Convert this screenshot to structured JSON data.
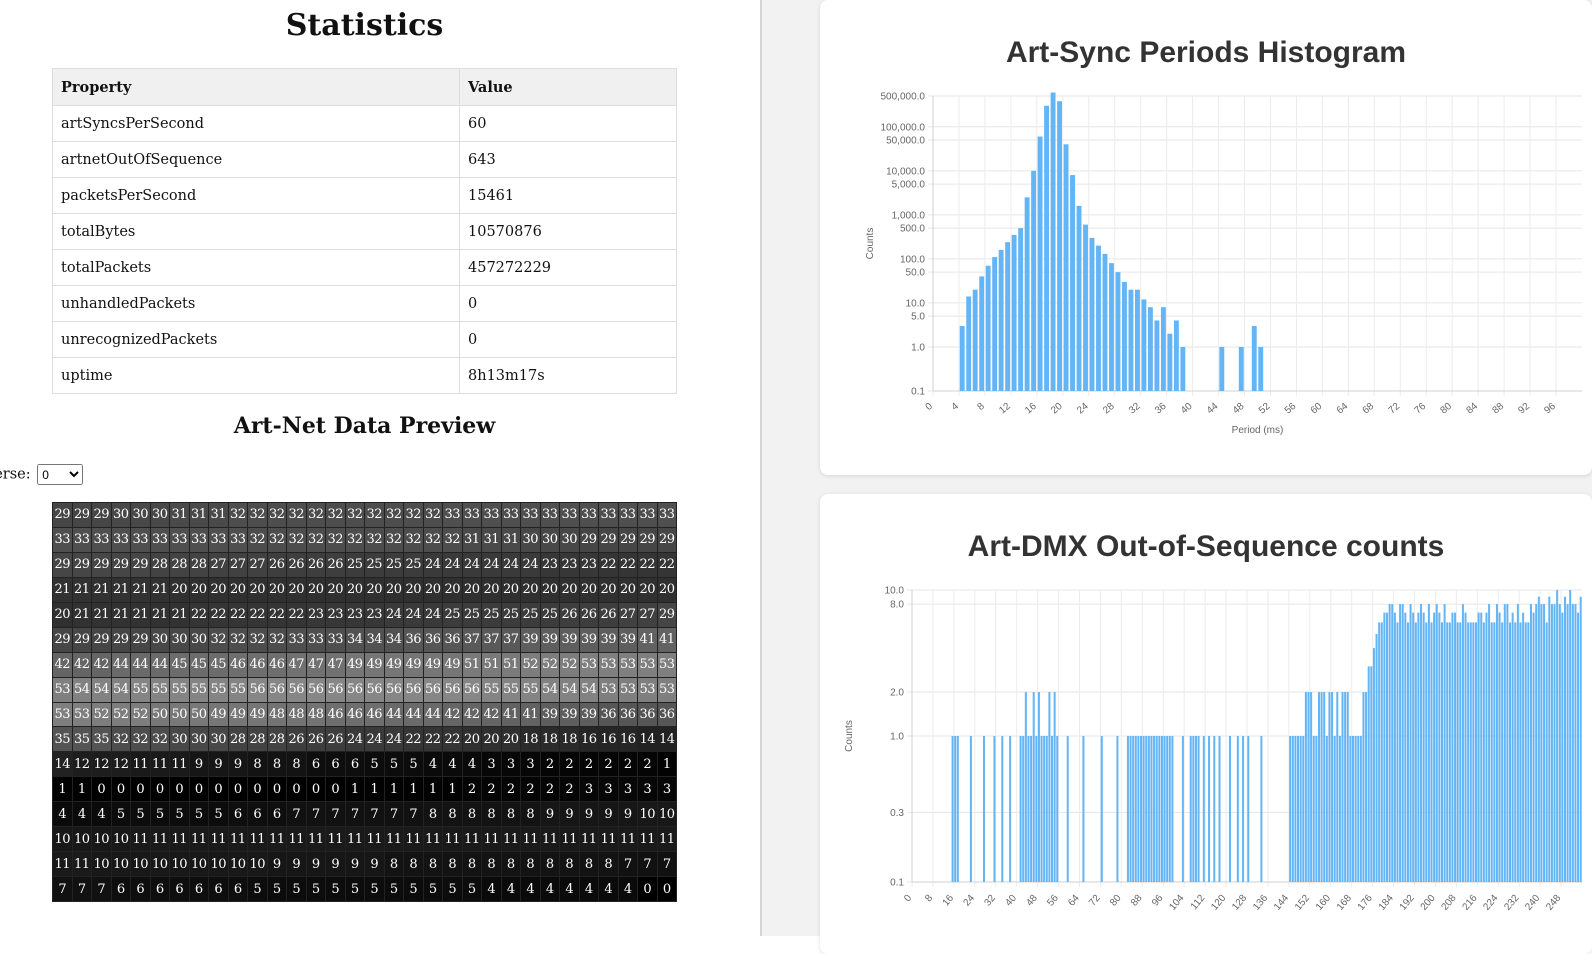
{
  "stats": {
    "title": "Statistics",
    "headers": [
      "Property",
      "Value"
    ],
    "rows": [
      {
        "k": "artSyncsPerSecond",
        "v": "60"
      },
      {
        "k": "artnetOutOfSequence",
        "v": "643"
      },
      {
        "k": "packetsPerSecond",
        "v": "15461"
      },
      {
        "k": "totalBytes",
        "v": "10570876"
      },
      {
        "k": "totalPackets",
        "v": "457272229"
      },
      {
        "k": "unhandledPackets",
        "v": "0"
      },
      {
        "k": "unrecognizedPackets",
        "v": "0"
      },
      {
        "k": "uptime",
        "v": "8h13m17s"
      }
    ]
  },
  "preview": {
    "title": "Art-Net Data Preview",
    "universe_label": "verse:",
    "universe_value": "0",
    "rows": [
      [
        29,
        29,
        29,
        30,
        30,
        30,
        31,
        31,
        31,
        32,
        32,
        32,
        32,
        32,
        32,
        32,
        32,
        32,
        32,
        32,
        33,
        33,
        33,
        33,
        33,
        33,
        33,
        33,
        33,
        33,
        33,
        33
      ],
      [
        33,
        33,
        33,
        33,
        33,
        33,
        33,
        33,
        33,
        33,
        32,
        32,
        32,
        32,
        32,
        32,
        32,
        32,
        32,
        32,
        32,
        31,
        31,
        31,
        30,
        30,
        30,
        29,
        29,
        29,
        29,
        29
      ],
      [
        29,
        29,
        29,
        29,
        29,
        28,
        28,
        28,
        27,
        27,
        27,
        26,
        26,
        26,
        26,
        25,
        25,
        25,
        25,
        24,
        24,
        24,
        24,
        24,
        24,
        23,
        23,
        23,
        22,
        22,
        22,
        22
      ],
      [
        21,
        21,
        21,
        21,
        21,
        21,
        20,
        20,
        20,
        20,
        20,
        20,
        20,
        20,
        20,
        20,
        20,
        20,
        20,
        20,
        20,
        20,
        20,
        20,
        20,
        20,
        20,
        20,
        20,
        20,
        20,
        20
      ],
      [
        20,
        21,
        21,
        21,
        21,
        21,
        21,
        22,
        22,
        22,
        22,
        22,
        22,
        23,
        23,
        23,
        23,
        24,
        24,
        24,
        25,
        25,
        25,
        25,
        25,
        25,
        26,
        26,
        26,
        27,
        27,
        29
      ],
      [
        29,
        29,
        29,
        29,
        29,
        30,
        30,
        30,
        32,
        32,
        32,
        32,
        33,
        33,
        33,
        34,
        34,
        34,
        36,
        36,
        36,
        37,
        37,
        37,
        39,
        39,
        39,
        39,
        39,
        39,
        41,
        41
      ],
      [
        42,
        42,
        42,
        44,
        44,
        44,
        45,
        45,
        45,
        46,
        46,
        46,
        47,
        47,
        47,
        49,
        49,
        49,
        49,
        49,
        49,
        51,
        51,
        51,
        52,
        52,
        52,
        53,
        53,
        53,
        53,
        53
      ],
      [
        53,
        54,
        54,
        54,
        55,
        55,
        55,
        55,
        55,
        55,
        56,
        56,
        56,
        56,
        56,
        56,
        56,
        56,
        56,
        56,
        56,
        56,
        55,
        55,
        55,
        54,
        54,
        54,
        53,
        53,
        53,
        53
      ],
      [
        53,
        53,
        52,
        52,
        52,
        50,
        50,
        50,
        49,
        49,
        49,
        48,
        48,
        48,
        46,
        46,
        46,
        44,
        44,
        44,
        42,
        42,
        42,
        41,
        41,
        39,
        39,
        39,
        36,
        36,
        36,
        36
      ],
      [
        35,
        35,
        35,
        32,
        32,
        32,
        30,
        30,
        30,
        28,
        28,
        28,
        26,
        26,
        26,
        24,
        24,
        24,
        22,
        22,
        22,
        20,
        20,
        20,
        18,
        18,
        18,
        16,
        16,
        16,
        14,
        14
      ],
      [
        14,
        12,
        12,
        12,
        11,
        11,
        11,
        9,
        9,
        9,
        8,
        8,
        8,
        6,
        6,
        6,
        5,
        5,
        5,
        4,
        4,
        4,
        3,
        3,
        3,
        2,
        2,
        2,
        2,
        2,
        2,
        1
      ],
      [
        1,
        1,
        0,
        0,
        0,
        0,
        0,
        0,
        0,
        0,
        0,
        0,
        0,
        0,
        0,
        1,
        1,
        1,
        1,
        1,
        1,
        2,
        2,
        2,
        2,
        2,
        2,
        3,
        3,
        3,
        3,
        3
      ],
      [
        4,
        4,
        4,
        5,
        5,
        5,
        5,
        5,
        5,
        6,
        6,
        6,
        7,
        7,
        7,
        7,
        7,
        7,
        7,
        8,
        8,
        8,
        8,
        8,
        8,
        9,
        9,
        9,
        9,
        9,
        10,
        10
      ],
      [
        10,
        10,
        10,
        10,
        11,
        11,
        11,
        11,
        11,
        11,
        11,
        11,
        11,
        11,
        11,
        11,
        11,
        11,
        11,
        11,
        11,
        11,
        11,
        11,
        11,
        11,
        11,
        11,
        11,
        11,
        11,
        11
      ],
      [
        11,
        11,
        10,
        10,
        10,
        10,
        10,
        10,
        10,
        10,
        10,
        9,
        9,
        9,
        9,
        9,
        9,
        8,
        8,
        8,
        8,
        8,
        8,
        8,
        8,
        8,
        8,
        8,
        8,
        7,
        7,
        7
      ],
      [
        7,
        7,
        7,
        6,
        6,
        6,
        6,
        6,
        6,
        6,
        5,
        5,
        5,
        5,
        5,
        5,
        5,
        5,
        5,
        5,
        5,
        5,
        4,
        4,
        4,
        4,
        4,
        4,
        4,
        4,
        0,
        0
      ]
    ]
  },
  "chart_data": [
    {
      "type": "bar",
      "title": "Art-Sync Periods Histogram",
      "xlabel": "Period (ms)",
      "ylabel": "Counts",
      "y_scale": "log",
      "ylim": [
        0.1,
        500000
      ],
      "y_ticks": [
        0.1,
        1,
        5,
        10,
        50,
        100,
        500,
        1000,
        5000,
        10000,
        50000,
        100000,
        500000
      ],
      "y_tick_labels": [
        "0.1",
        "1.0",
        "5.0",
        "10.0",
        "50.0",
        "100.0",
        "500.0",
        "1,000.0",
        "5,000.0",
        "10,000.0",
        "50,000.0",
        "100,000.0",
        "500,000.0"
      ],
      "x_tick_labels": [
        "0",
        "4",
        "8",
        "12",
        "16",
        "20",
        "24",
        "28",
        "32",
        "36",
        "40",
        "44",
        "48",
        "52",
        "56",
        "60",
        "64",
        "68",
        "72",
        "76",
        "80",
        "84",
        "88",
        "92",
        "96"
      ],
      "x": [
        0,
        1,
        2,
        3,
        4,
        5,
        6,
        7,
        8,
        9,
        10,
        11,
        12,
        13,
        14,
        15,
        16,
        17,
        18,
        19,
        20,
        21,
        22,
        23,
        24,
        25,
        26,
        27,
        28,
        29,
        30,
        31,
        32,
        33,
        34,
        35,
        36,
        37,
        38,
        39,
        40,
        41,
        42,
        43,
        44,
        45,
        46,
        47,
        48,
        49,
        50,
        51,
        52,
        53,
        54,
        55,
        56,
        57,
        58,
        59,
        60,
        61,
        62,
        63,
        64,
        65,
        66,
        67,
        68,
        69,
        70,
        71,
        72,
        73,
        74,
        75,
        76,
        77,
        78,
        79,
        80,
        81,
        82,
        83,
        84,
        85,
        86,
        87,
        88,
        89,
        90,
        91,
        92,
        93,
        94,
        95,
        96,
        97,
        98,
        99
      ],
      "values": [
        0,
        0,
        0,
        0,
        3,
        14,
        20,
        40,
        70,
        110,
        160,
        240,
        350,
        500,
        2500,
        10000,
        60000,
        300000,
        600000,
        380000,
        40000,
        8000,
        1600,
        600,
        300,
        200,
        130,
        80,
        50,
        30,
        20,
        20,
        12,
        8,
        4,
        8,
        2,
        4,
        1,
        0,
        0,
        0,
        0,
        0,
        1,
        0,
        0,
        1,
        0,
        3,
        1,
        0,
        0,
        0,
        0,
        0,
        0,
        0,
        0,
        0,
        0,
        0,
        0,
        0,
        0,
        0,
        0,
        0,
        0,
        0,
        0,
        0,
        0,
        0,
        0,
        0,
        0,
        0,
        0,
        0,
        0,
        0,
        0,
        0,
        0,
        0,
        0,
        0,
        0,
        0,
        0,
        0,
        0,
        0,
        0,
        0,
        0,
        0,
        0,
        0
      ],
      "grid": true,
      "color": "#64b5f6"
    },
    {
      "type": "bar",
      "title": "Art-DMX Out-of-Sequence counts",
      "xlabel": "",
      "ylabel": "Counts",
      "y_scale": "log",
      "ylim": [
        0.1,
        10
      ],
      "y_ticks": [
        0.1,
        0.3,
        1,
        2,
        8,
        10
      ],
      "y_tick_labels": [
        "0.1",
        "0.3",
        "1.0",
        "2.0",
        "8.0",
        "10.0"
      ],
      "x_tick_labels": [
        "0",
        "8",
        "16",
        "24",
        "32",
        "40",
        "48",
        "56",
        "64",
        "72",
        "80",
        "88",
        "96",
        "104",
        "112",
        "120",
        "128",
        "136",
        "144",
        "152",
        "160",
        "168",
        "176",
        "184",
        "192",
        "200",
        "208",
        "216",
        "224",
        "232",
        "240",
        "248"
      ],
      "x_range": [
        0,
        256
      ],
      "ones_at": [
        15,
        16,
        17,
        22,
        27,
        31,
        34,
        37,
        41,
        42,
        44,
        45,
        46,
        47,
        48,
        49,
        50,
        51,
        53,
        54,
        55,
        59,
        65,
        72,
        78,
        82,
        83,
        84,
        85,
        86,
        87,
        88,
        89,
        90,
        91,
        92,
        93,
        94,
        95,
        96,
        97,
        98,
        99,
        103,
        106,
        107,
        108,
        109,
        111,
        113,
        115,
        117,
        121,
        124,
        126,
        128,
        133
      ],
      "twos_at": [
        43,
        46,
        48,
        52,
        54
      ],
      "dense_start": 144,
      "dense_values": [
        1,
        1,
        1,
        1,
        1,
        1,
        2,
        2,
        2,
        1,
        1,
        2,
        2,
        2,
        1,
        2,
        2,
        1,
        2,
        1,
        2,
        2,
        2,
        1,
        1,
        1,
        1,
        1,
        2,
        2,
        3,
        3,
        4,
        5,
        6,
        6,
        7,
        7,
        8,
        8,
        7,
        6,
        8,
        8,
        7,
        6,
        8,
        7,
        6,
        7,
        8,
        7,
        6,
        8,
        6,
        7,
        8,
        7,
        6,
        8,
        6,
        6,
        7,
        7,
        6,
        6,
        8,
        7,
        6,
        6,
        6,
        6,
        7,
        7,
        6,
        7,
        8,
        6,
        6,
        8,
        7,
        6,
        8,
        8,
        6,
        7,
        6,
        8,
        6,
        7,
        6,
        6,
        8,
        7,
        8,
        9,
        8,
        8,
        6,
        9,
        8,
        8,
        10,
        8,
        7,
        9,
        8,
        10,
        8,
        8,
        7,
        9,
        8,
        10,
        8,
        7,
        8,
        8,
        8,
        9,
        7,
        8
      ],
      "grid": true,
      "color": "#64b5f6"
    }
  ]
}
